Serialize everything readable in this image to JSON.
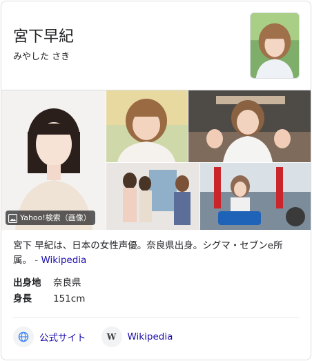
{
  "header": {
    "title": "宮下早紀",
    "subtitle": "みやした さき"
  },
  "gallery": {
    "badge_label": "Yahoo!検索（画像）",
    "badge_icon": "image-icon"
  },
  "description": {
    "text": "宮下 早紀は、日本の女性声優。奈良県出身。シグマ・セブンe所属。",
    "separator": "- ",
    "source_link": "Wikipedia"
  },
  "facts": [
    {
      "key": "出身地",
      "value": "奈良県"
    },
    {
      "key": "身長",
      "value": "151cm"
    }
  ],
  "links": [
    {
      "label": "公式サイト",
      "icon": "globe-icon"
    },
    {
      "label": "Wikipedia",
      "icon": "wikipedia-icon"
    }
  ],
  "colors": {
    "link": "#1a0dab",
    "border": "#dadce0",
    "text": "#202124"
  }
}
